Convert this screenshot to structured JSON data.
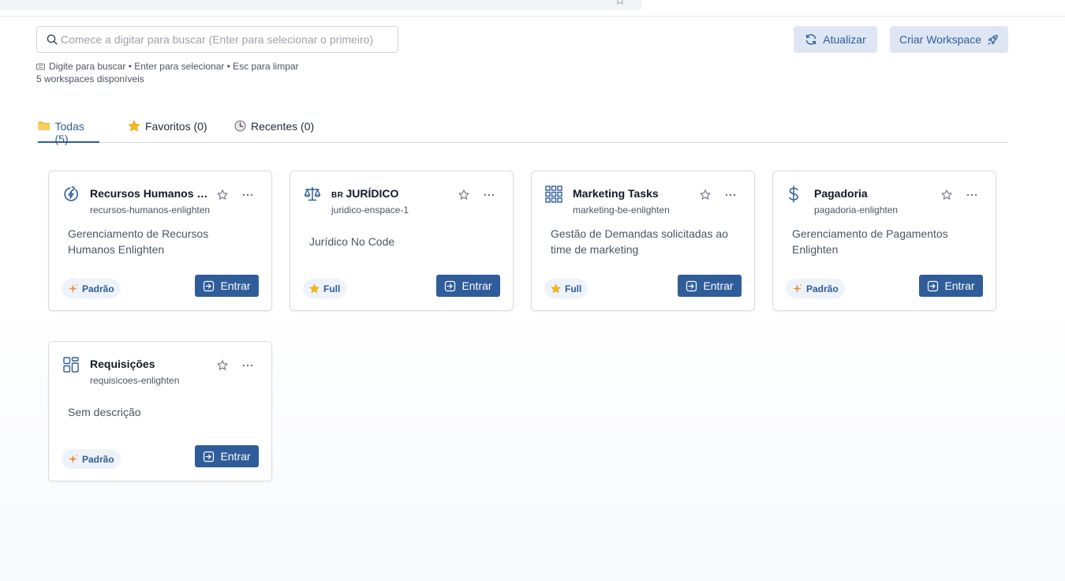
{
  "search": {
    "placeholder": "Comece a digitar para buscar (Enter para selecionar o primeiro)",
    "value": "",
    "hint": "Digite para buscar • Enter para selecionar • Esc para limpar",
    "count_text": "5 workspaces disponíveis"
  },
  "toolbar": {
    "refresh_label": "Atualizar",
    "create_label": "Criar Workspace"
  },
  "tabs": [
    {
      "label": "Todas (5)",
      "icon": "folder-icon",
      "active": true
    },
    {
      "label": "Favoritos (0)",
      "icon": "star-icon",
      "active": false
    },
    {
      "label": "Recentes (0)",
      "icon": "clock-icon",
      "active": false
    }
  ],
  "workspaces": [
    {
      "title": "Recursos Humanos E...",
      "slug": "recursos-humanos-enlighten",
      "description": "Gerenciamento de Recursos Humanos Enlighten",
      "badge": "Padrão",
      "badge_icon": "sparkle-icon",
      "icon": "lightning-refresh-icon",
      "enter_label": "Entrar"
    },
    {
      "flag": "BR",
      "title": "JURÍDICO",
      "slug": "juridico-enspace-1",
      "description": "Jurídico No Code",
      "badge": "Full",
      "badge_icon": "star-icon",
      "icon": "scales-icon",
      "enter_label": "Entrar"
    },
    {
      "title": "Marketing Tasks",
      "slug": "marketing-be-enlighten",
      "description": "Gestão de Demandas solicitadas ao time de marketing",
      "badge": "Full",
      "badge_icon": "star-icon",
      "icon": "grid-icon",
      "enter_label": "Entrar"
    },
    {
      "title": "Pagadoria",
      "slug": "pagadoria-enlighten",
      "description": "Gerenciamento de Pagamentos Enlighten",
      "badge": "Padrão",
      "badge_icon": "sparkle-icon",
      "icon": "dollar-icon",
      "enter_label": "Entrar"
    },
    {
      "title": "Requisições",
      "slug": "requisicoes-enlighten",
      "description": "Sem descrição",
      "badge": "Padrão",
      "badge_icon": "sparkle-icon",
      "icon": "layout-icon",
      "enter_label": "Entrar"
    }
  ],
  "colors": {
    "accent": "#2f5d9a",
    "secondary_button_bg": "#dde6f2",
    "badge_bg": "#eef3fa",
    "star_yellow": "#f5b819",
    "sparkle_orange": "#f08a3c"
  }
}
